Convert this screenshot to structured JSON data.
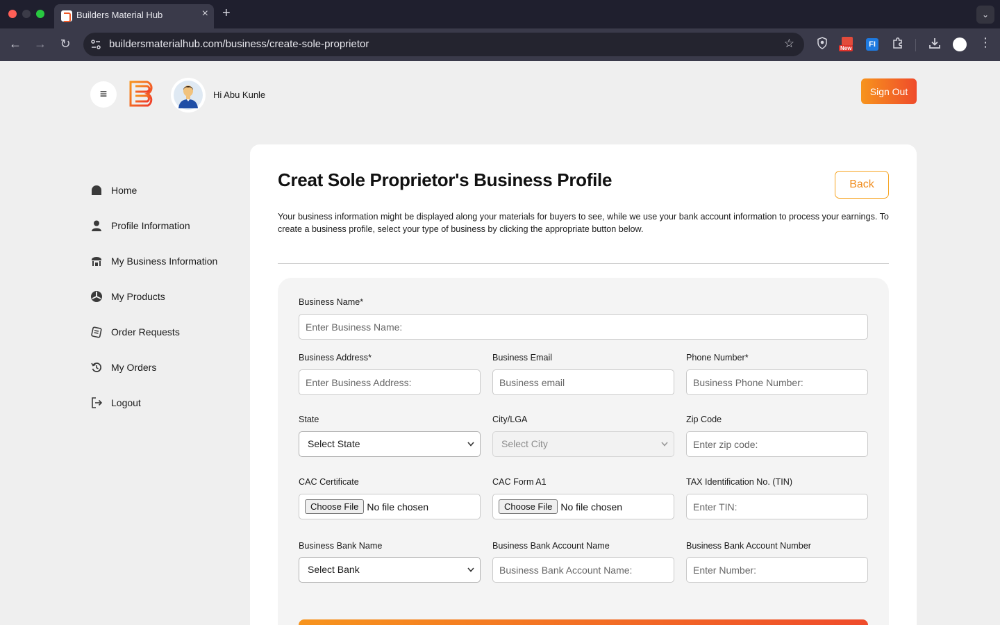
{
  "browser": {
    "tab_title": "Builders Material Hub",
    "url": "buildersmaterialhub.com/business/create-sole-proprietor",
    "new_badge": "New",
    "fi_label": "FI"
  },
  "header": {
    "greeting": "Hi Abu Kunle",
    "signout_label": "Sign Out",
    "brand_color": "#f05a28"
  },
  "sidebar": {
    "items": [
      {
        "label": "Home",
        "icon": "home-icon"
      },
      {
        "label": "Profile Information",
        "icon": "user-icon"
      },
      {
        "label": "My Business Information",
        "icon": "business-icon"
      },
      {
        "label": "My Products",
        "icon": "products-icon"
      },
      {
        "label": "Order Requests",
        "icon": "order-requests-icon"
      },
      {
        "label": "My Orders",
        "icon": "my-orders-icon"
      },
      {
        "label": "Logout",
        "icon": "logout-icon"
      }
    ]
  },
  "main": {
    "title": "Creat Sole Proprietor's Business Profile",
    "back_label": "Back",
    "intro": "Your business information might be displayed along your materials for buyers to see, while we use your bank account information to process your earnings. To create a business profile, select your type of business by clicking the appropriate button below."
  },
  "form": {
    "business_name": {
      "label": "Business Name*",
      "placeholder": "Enter Business Name:"
    },
    "business_address": {
      "label": "Business Address*",
      "placeholder": "Enter Business Address:"
    },
    "business_email": {
      "label": "Business Email",
      "placeholder": "Business email"
    },
    "phone_number": {
      "label": "Phone Number*",
      "placeholder": "Business Phone Number:"
    },
    "state": {
      "label": "State",
      "value": "Select State"
    },
    "city": {
      "label": "City/LGA",
      "value": "Select City"
    },
    "zip": {
      "label": "Zip Code",
      "placeholder": "Enter zip code:"
    },
    "cac_certificate": {
      "label": "CAC Certificate",
      "button": "Choose File",
      "status": "No file chosen"
    },
    "cac_form": {
      "label": "CAC Form A1",
      "button": "Choose File",
      "status": "No file chosen"
    },
    "tin": {
      "label": "TAX Identification No. (TIN)",
      "placeholder": "Enter TIN:"
    },
    "bank_name": {
      "label": "Business Bank Name",
      "value": "Select Bank"
    },
    "account_name": {
      "label": "Business Bank Account Name",
      "placeholder": "Business Bank Account Name:"
    },
    "account_number": {
      "label": "Business Bank Account Number",
      "placeholder": "Enter Number:"
    }
  }
}
